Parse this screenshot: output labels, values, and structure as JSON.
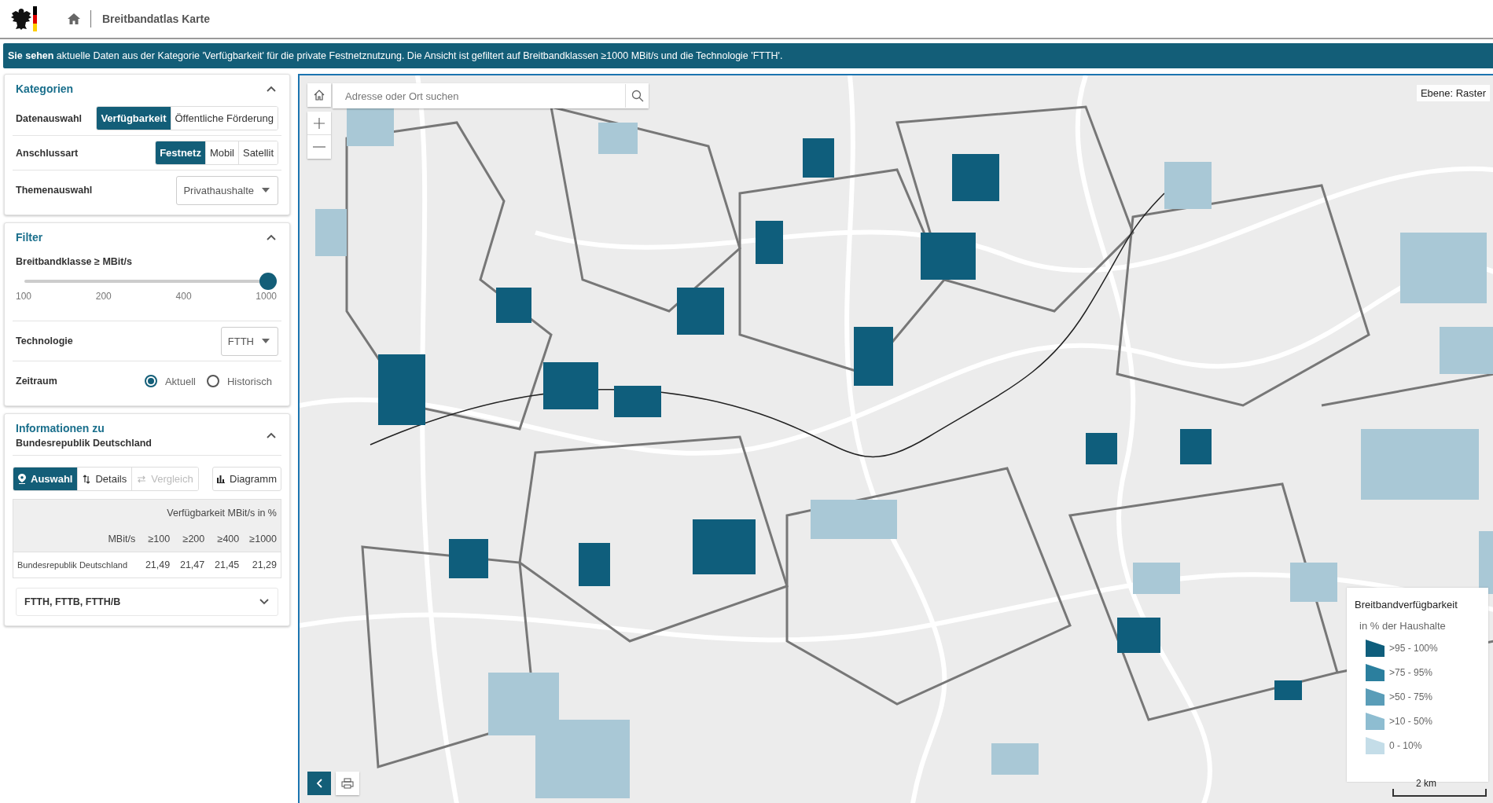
{
  "header": {
    "title": "Breitbandatlas Karte"
  },
  "banner": {
    "text": "**Sie sehen** aktuelle Daten aus der Kategorie 'Verfügbarkeit' für die private Festnetznutzung. Die Ansicht ist gefiltert auf Breitbandklassen ≥1000 MBit/s und die Technologie 'FTTH'."
  },
  "categories": {
    "title": "Kategorien",
    "expanded": true,
    "rows": [
      {
        "kind": "segmented",
        "label": "Datenauswahl",
        "options": [
          {
            "label": "Verfügbarkeit",
            "selected": true
          },
          {
            "label": "Öffentliche Förderung",
            "selected": false
          }
        ]
      },
      {
        "kind": "segmented",
        "label": "Anschlussart",
        "options": [
          {
            "label": "Festnetz",
            "selected": true
          },
          {
            "label": "Mobil",
            "selected": false
          },
          {
            "label": "Satellit",
            "selected": false
          }
        ]
      },
      {
        "kind": "dropdown",
        "label": "Themenauswahl",
        "value": "Privathaushalte"
      }
    ]
  },
  "filter": {
    "title": "Filter",
    "expanded": true,
    "slider": {
      "label": "Breitbandklasse ≥ MBit/s",
      "level": 1,
      "ticks": [
        "100",
        "200",
        "400",
        "1000"
      ]
    },
    "technology": {
      "label": "Technologie",
      "value": "FTTH"
    },
    "period": {
      "label": "Zeitraum",
      "options": [
        {
          "label": "Aktuell",
          "selected": true
        },
        {
          "label": "Historisch",
          "selected": false
        }
      ]
    }
  },
  "info": {
    "title": "Informationen zu",
    "subtitle": "Bundesrepublik Deutschland",
    "expanded": true,
    "tabs": [
      {
        "label": "Auswahl",
        "selected": true,
        "disabled": false
      },
      {
        "label": "Details",
        "selected": false,
        "disabled": false
      },
      {
        "label": "Vergleich",
        "selected": false,
        "disabled": true
      }
    ],
    "chart_button": "Diagramm",
    "table": {
      "caption": "Verfügbarkeit MBit/s in %",
      "columns": [
        "MBit/s",
        "≥100",
        "≥200",
        "≥400",
        "≥1000"
      ],
      "rows": [
        {
          "name": "Bundesrepublik Deutschland",
          "values": [
            "21,49",
            "21,47",
            "21,45",
            "21,29"
          ]
        }
      ]
    },
    "accordion": {
      "label": "FTTH, FTTB, FTTH/B",
      "expanded": false
    }
  },
  "map": {
    "search": {
      "placeholder": "Adresse oder Ort suchen"
    },
    "layer": "Ebene: Raster",
    "scale": "2 km",
    "legend": {
      "title": "Breitbandverfügbarkeit",
      "subtitle": "in % der Haushalte",
      "items": [
        {
          "label": ">95 - 100%",
          "color": "#0f5e7c"
        },
        {
          "label": ">75 - 95%",
          "color": "#2b7f9e"
        },
        {
          "label": ">50 - 75%",
          "color": "#5a9db8"
        },
        {
          "label": ">10 - 50%",
          "color": "#8ebdd1"
        },
        {
          "label": "0 - 10%",
          "color": "#c4dde8"
        }
      ]
    }
  }
}
